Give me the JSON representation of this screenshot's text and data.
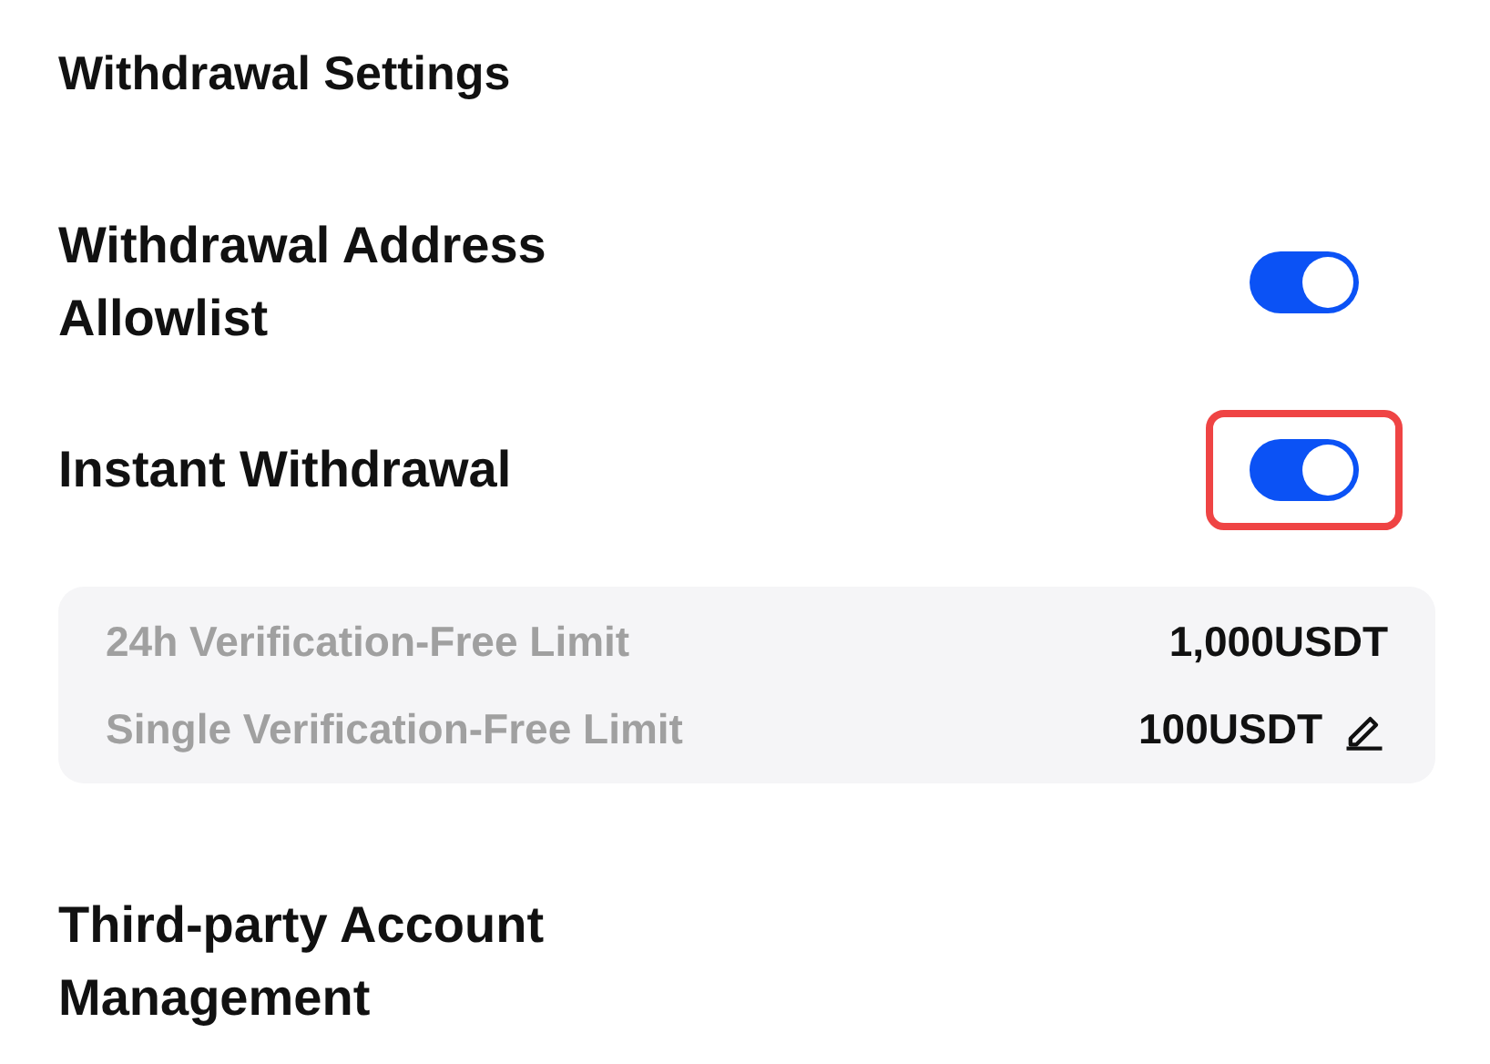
{
  "section_title": "Withdrawal Settings",
  "settings": [
    {
      "label": "Withdrawal Address Allowlist",
      "on": true,
      "highlighted": false
    },
    {
      "label": "Instant Withdrawal",
      "on": true,
      "highlighted": true
    }
  ],
  "limits": [
    {
      "label": "24h Verification-Free Limit",
      "value": "1,000USDT",
      "editable": false
    },
    {
      "label": "Single Verification-Free Limit",
      "value": "100USDT",
      "editable": true
    }
  ],
  "next_section_title": "Third-party Account Management"
}
